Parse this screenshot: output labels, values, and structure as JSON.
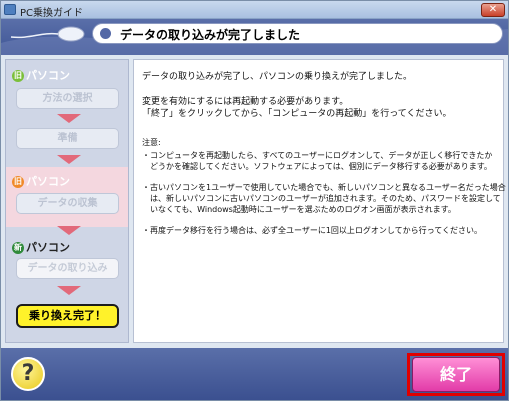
{
  "window": {
    "title": "PC乗換ガイド",
    "close_glyph": "✕"
  },
  "header": {
    "title": "データの取り込みが完了しました"
  },
  "sidebar": {
    "old_section": {
      "badge": "旧",
      "label": "パソコン"
    },
    "steps_old": [
      "方法の選択",
      "準備"
    ],
    "old2_section": {
      "badge": "旧",
      "label": "パソコン"
    },
    "collect_step": "データの収集",
    "new_section": {
      "badge": "新",
      "label": "パソコン"
    },
    "import_step": "データの取り込み",
    "done_label": "乗り換え完了！"
  },
  "content": {
    "lines": [
      "データの取り込みが完了し、パソコンの乗り換えが完了しました。",
      "変更を有効にするには再起動する必要があります。",
      "「終了」をクリックしてから、「コンピュータの再起動」を行ってください。"
    ],
    "note_title": "注意:",
    "notes": [
      "・コンピュータを再起動したら、すべてのユーザーにログオンして、データが正しく移行できたか",
      "　どうかを確認してください。ソフトウェアによっては、個別にデータ移行する必要があります。",
      "・古いパソコンを1ユーザーで使用していた場合でも、新しいパソコンと異なるユーザー名だった場合",
      "　は、新しいパソコンに古いパソコンのユーザーが追加されます。そのため、パスワードを設定して",
      "　いなくても、Windows起動時にユーザーを選ぶためのログオン画面が表示されます。",
      "・再度データ移行を行う場合は、必ず全ユーザーに1回以上ログオンしてから行ってください。"
    ]
  },
  "footer": {
    "help_glyph": "?",
    "end_label": "終了"
  },
  "colors": {
    "accent": "#4a5f9e",
    "arrow": "#e2697a",
    "done": "#fff22a",
    "end": "#e23ba8",
    "highlight": "#e00000"
  }
}
